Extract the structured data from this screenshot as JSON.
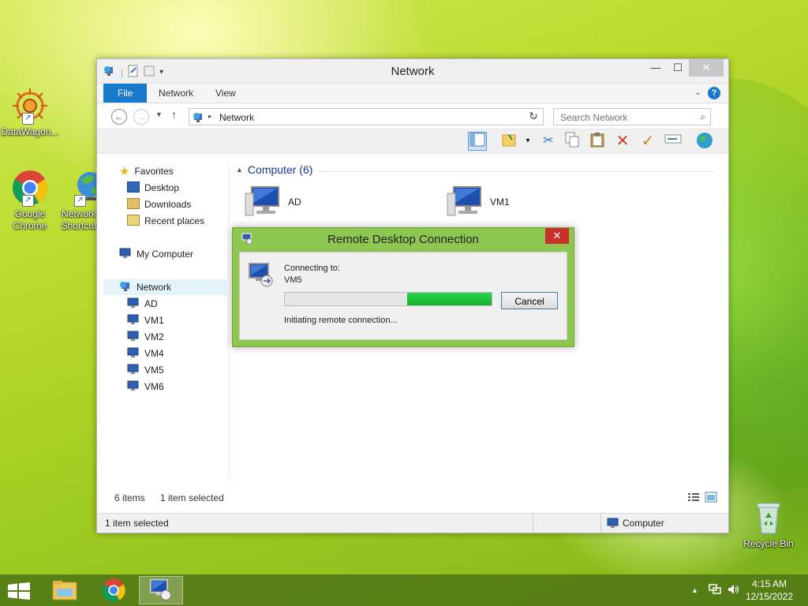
{
  "desktop": {
    "icons": [
      {
        "label": "DataWagon..."
      },
      {
        "label": "Google Chrome"
      },
      {
        "label": "Network Shortcut"
      },
      {
        "label": "Recycle Bin"
      }
    ]
  },
  "explorer": {
    "title": "Network",
    "ribbon_tabs": [
      "File",
      "Network",
      "View"
    ],
    "address": "Network",
    "search_placeholder": "Search Network",
    "nav": {
      "favorites": "Favorites",
      "favorites_items": [
        "Desktop",
        "Downloads",
        "Recent places"
      ],
      "my_computer": "My Computer",
      "network": "Network",
      "network_items": [
        "AD",
        "VM1",
        "VM2",
        "VM4",
        "VM5",
        "VM6"
      ]
    },
    "content": {
      "group_header": "Computer (6)",
      "items": [
        "AD",
        "VM1"
      ]
    },
    "status": {
      "item_count": "6 items",
      "selected": "1 item selected",
      "bottom_left": "1 item selected",
      "bottom_right": "Computer"
    }
  },
  "rdc_dialog": {
    "title": "Remote Desktop Connection",
    "connecting_label": "Connecting to:",
    "target": "VM5",
    "cancel_label": "Cancel",
    "status_text": "Initiating remote connection...",
    "progress_indicator": {
      "start": 0.59,
      "end": 1.0
    }
  },
  "taskbar": {
    "time": "4:15 AM",
    "date": "12/15/2022"
  },
  "colors": {
    "accent": "#1979ca",
    "dialog_frame": "#8dc751",
    "progress": "#1bc03a",
    "close_red": "#c9302c"
  }
}
